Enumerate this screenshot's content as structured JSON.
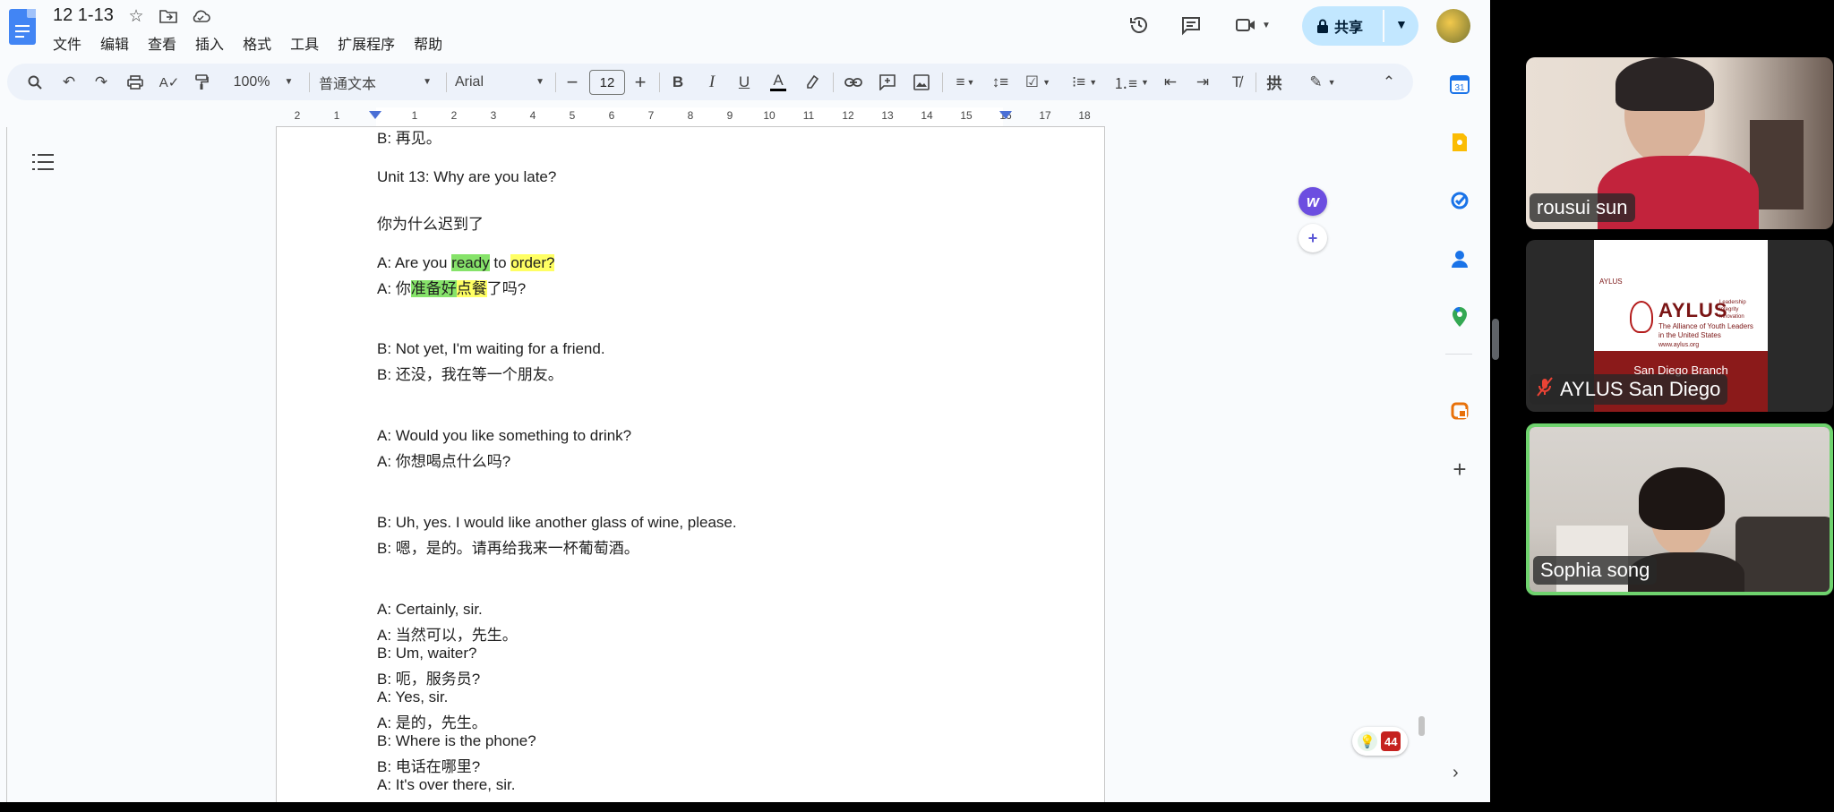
{
  "doc": {
    "title": "12 1-13",
    "menu": [
      "文件",
      "编辑",
      "查看",
      "插入",
      "格式",
      "工具",
      "扩展程序",
      "帮助"
    ],
    "share_label": "共享"
  },
  "toolbar": {
    "zoom": "100%",
    "style": "普通文本",
    "font": "Arial",
    "font_size": "12"
  },
  "ruler": {
    "numbers": [
      "2",
      "1",
      "1",
      "2",
      "3",
      "4",
      "5",
      "6",
      "7",
      "8",
      "9",
      "10",
      "11",
      "12",
      "13",
      "14",
      "15",
      "16",
      "17",
      "18"
    ]
  },
  "content": {
    "line_0": "B: 再见。",
    "line_1": "Unit 13: Why are you late?",
    "line_2": "你为什么迟到了",
    "l3_a": "A: Are you ",
    "l3_b": "ready",
    "l3_c": " to ",
    "l3_d": "order?",
    "l4_a": "A: 你",
    "l4_b": "准备好",
    "l4_c": "点餐",
    "l4_d": "了吗?",
    "line_5": "B: Not yet, I'm waiting for a friend.",
    "line_6": "B: 还没，我在等一个朋友。",
    "line_7": "A: Would you like something to drink?",
    "line_8": "A: 你想喝点什么吗?",
    "line_9": "B: Uh, yes. I would like another glass of wine, please.",
    "line_10": "B: 嗯，是的。请再给我来一杯葡萄酒。",
    "line_11": "A: Certainly, sir.",
    "line_12": "A: 当然可以，先生。",
    "line_13": "B: Um, waiter?",
    "line_14": "B: 呃，服务员?",
    "line_15": "A: Yes, sir.",
    "line_16": "A: 是的，先生。",
    "line_17": "B: Where is the phone?",
    "line_18": "B: 电话在哪里?",
    "line_19": "A: It's over there, sir."
  },
  "badge": {
    "count": "44"
  },
  "participants": [
    {
      "name": "rousui sun"
    },
    {
      "name": "AYLUS San Diego"
    },
    {
      "name": "Sophia song"
    }
  ],
  "aylus_slide": {
    "small": "AYLUS",
    "title": "AYLUS",
    "subtitle": "The Alliance of Youth Leaders in the United States",
    "url": "www.aylus.org",
    "tagline": "Leadership Integrity Innovation",
    "branch": "San Diego Branch"
  },
  "colors": {
    "highlight_green": "#86e36a",
    "highlight_yellow": "#ffff63",
    "share_bg": "#c2e7ff",
    "active_tile": "#6fd36e"
  }
}
